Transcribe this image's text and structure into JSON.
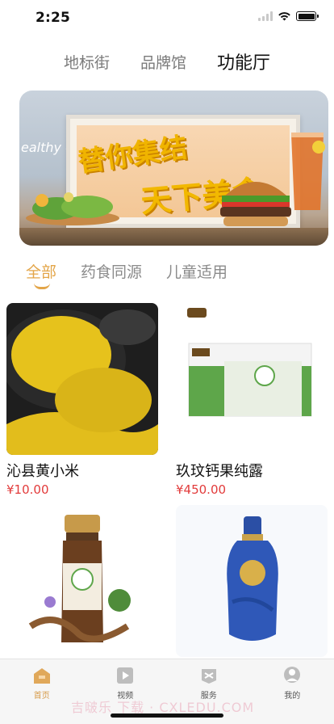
{
  "status": {
    "time": "2:25"
  },
  "top_tabs": [
    {
      "label": "地标街",
      "active": false
    },
    {
      "label": "品牌馆",
      "active": false
    },
    {
      "label": "功能厅",
      "active": true
    }
  ],
  "banner": {
    "line1": "替你集结",
    "line2": "天下美食",
    "healthy_text": "ealthy ood"
  },
  "category_tabs": [
    {
      "label": "全部",
      "active": true
    },
    {
      "label": "药食同源",
      "active": false
    },
    {
      "label": "儿童适用",
      "active": false
    }
  ],
  "products": [
    {
      "name": "沁县黄小米",
      "price": "¥10.00",
      "image": "millet"
    },
    {
      "name": "玖玟钙果纯露",
      "price": "¥450.00",
      "image": "box"
    },
    {
      "name": "",
      "price": "",
      "image": "bottle"
    },
    {
      "name": "",
      "price": "",
      "image": "liquor"
    }
  ],
  "tab_bar": [
    {
      "label": "首页",
      "icon": "home-icon",
      "active": true
    },
    {
      "label": "视频",
      "icon": "video-icon",
      "active": false
    },
    {
      "label": "服务",
      "icon": "service-icon",
      "active": false
    },
    {
      "label": "我的",
      "icon": "profile-icon",
      "active": false
    }
  ],
  "watermark": "吉啵乐 下载 · CXLEDU.COM",
  "colors": {
    "accent": "#e3a548",
    "price": "#e23b3b",
    "tab_active": "#d79c4b"
  }
}
